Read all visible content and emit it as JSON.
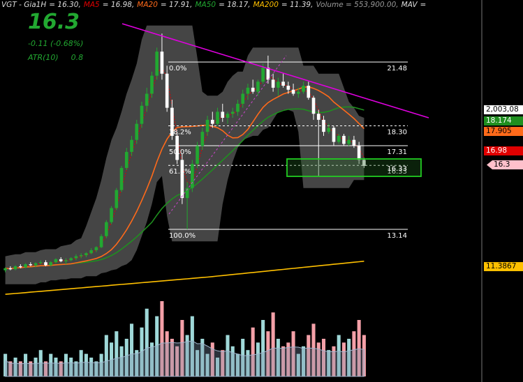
{
  "header": {
    "symbol": "VGT - Gia1H",
    "price_text": "= 16.30,",
    "ma5_label": "MA5",
    "ma5_text": "= 16.98,",
    "ma20_label": "MA20",
    "ma20_text": "= 17.91,",
    "ma50_label": "MA50",
    "ma50_text": "= 18.17,",
    "ma200_label": "MA200",
    "ma200_text": "= 11.39,",
    "volume_text": "Volume = 553,900.00,",
    "mav_label": "MAV",
    "mav_text": "="
  },
  "quote": {
    "price": "16.3",
    "change": "-0.11  (-0.68%)",
    "atr_label": "ATR(10)",
    "atr_value": "0.8"
  },
  "axis_tags": [
    {
      "text": "2,003,08",
      "bg": "#ffffff",
      "fg": "#000000"
    },
    {
      "text": "18.174",
      "bg": "#1f8f1f",
      "fg": "#ffffff"
    },
    {
      "text": "17.905",
      "bg": "#ff6a1a",
      "fg": "#000000"
    },
    {
      "text": "16.98",
      "bg": "#e00000",
      "fg": "#ffffff"
    },
    {
      "text": "16.3",
      "bg": "#ffc0cb",
      "fg": "#000000"
    },
    {
      "text": "11.3867",
      "bg": "#ffc000",
      "fg": "#000000"
    }
  ],
  "colors": {
    "up": "#22a831",
    "down": "#ffffff",
    "ma5": "#e00000",
    "ma20": "#ff6a1a",
    "ma50": "#1f8f1f",
    "ma200": "#ffc000",
    "trendline": "#e000e0",
    "box": "#22cc22",
    "vol_up": "#9fd8d8",
    "vol_down": "#f4a0a8"
  },
  "chart_data": {
    "type": "candlestick",
    "title": "VGT - Gia1H",
    "ylim": [
      9.5,
      24.0
    ],
    "grid": false,
    "fibonacci": [
      {
        "label": "0.0%",
        "value": 21.48
      },
      {
        "label": "38.2%",
        "value": 18.3
      },
      {
        "label": "50.0%",
        "value": 17.31
      },
      {
        "label": "61.8%",
        "value": 16.33
      },
      {
        "label": "100.0%",
        "value": 13.14
      }
    ],
    "candles": [
      [
        11.1,
        11.25,
        11.0,
        11.2
      ],
      [
        11.2,
        11.3,
        11.1,
        11.15
      ],
      [
        11.15,
        11.35,
        11.1,
        11.3
      ],
      [
        11.3,
        11.4,
        11.2,
        11.25
      ],
      [
        11.25,
        11.45,
        11.2,
        11.4
      ],
      [
        11.4,
        11.5,
        11.3,
        11.35
      ],
      [
        11.35,
        11.5,
        11.25,
        11.45
      ],
      [
        11.45,
        11.6,
        11.4,
        11.5
      ],
      [
        11.5,
        11.6,
        11.3,
        11.35
      ],
      [
        11.35,
        11.55,
        11.3,
        11.5
      ],
      [
        11.5,
        11.7,
        11.45,
        11.65
      ],
      [
        11.65,
        11.75,
        11.5,
        11.55
      ],
      [
        11.55,
        11.7,
        11.4,
        11.6
      ],
      [
        11.6,
        11.75,
        11.55,
        11.7
      ],
      [
        11.7,
        11.9,
        11.6,
        11.8
      ],
      [
        11.8,
        11.95,
        11.7,
        11.85
      ],
      [
        11.85,
        12.0,
        11.75,
        11.95
      ],
      [
        11.95,
        12.2,
        11.9,
        12.1
      ],
      [
        12.1,
        12.3,
        12.0,
        12.25
      ],
      [
        12.25,
        12.9,
        12.2,
        12.8
      ],
      [
        12.8,
        13.6,
        12.7,
        13.5
      ],
      [
        13.5,
        14.3,
        13.4,
        14.2
      ],
      [
        14.2,
        15.2,
        14.1,
        15.1
      ],
      [
        15.1,
        16.3,
        15.0,
        16.2
      ],
      [
        16.2,
        17.2,
        16.1,
        17.0
      ],
      [
        17.0,
        17.8,
        16.8,
        17.6
      ],
      [
        17.6,
        18.6,
        17.4,
        18.4
      ],
      [
        18.4,
        19.5,
        18.2,
        19.3
      ],
      [
        19.3,
        20.2,
        19.0,
        19.9
      ],
      [
        19.9,
        21.0,
        19.7,
        20.8
      ],
      [
        20.8,
        22.2,
        20.6,
        22.0
      ],
      [
        22.0,
        22.9,
        20.6,
        20.9
      ],
      [
        20.9,
        21.3,
        19.0,
        19.2
      ],
      [
        19.2,
        19.6,
        17.6,
        17.8
      ],
      [
        17.8,
        18.0,
        16.4,
        16.6
      ],
      [
        16.6,
        16.9,
        14.4,
        14.7
      ],
      [
        14.7,
        15.5,
        13.14,
        15.2
      ],
      [
        15.2,
        16.6,
        15.0,
        16.4
      ],
      [
        16.4,
        17.5,
        16.2,
        17.3
      ],
      [
        17.3,
        18.2,
        17.1,
        18.0
      ],
      [
        18.0,
        18.8,
        17.8,
        18.6
      ],
      [
        18.6,
        19.0,
        18.2,
        18.4
      ],
      [
        18.4,
        19.2,
        18.3,
        19.0
      ],
      [
        19.0,
        19.4,
        18.5,
        18.7
      ],
      [
        18.7,
        19.0,
        18.4,
        18.9
      ],
      [
        18.9,
        19.2,
        18.7,
        19.0
      ],
      [
        19.0,
        19.6,
        18.8,
        19.4
      ],
      [
        19.4,
        20.1,
        19.2,
        19.9
      ],
      [
        19.9,
        20.4,
        19.6,
        20.2
      ],
      [
        20.2,
        20.6,
        19.9,
        20.0
      ],
      [
        20.0,
        20.6,
        19.8,
        20.5
      ],
      [
        20.5,
        21.4,
        20.4,
        21.2
      ],
      [
        21.2,
        21.8,
        20.4,
        20.6
      ],
      [
        20.6,
        20.9,
        20.0,
        20.2
      ],
      [
        20.2,
        20.7,
        19.8,
        20.5
      ],
      [
        20.5,
        20.9,
        20.2,
        20.3
      ],
      [
        20.3,
        20.5,
        19.9,
        20.1
      ],
      [
        20.1,
        20.4,
        19.8,
        19.9
      ],
      [
        19.9,
        20.2,
        19.7,
        20.0
      ],
      [
        20.0,
        20.5,
        19.9,
        20.3
      ],
      [
        20.3,
        20.5,
        19.6,
        19.7
      ],
      [
        19.7,
        19.8,
        18.6,
        18.9
      ],
      [
        18.9,
        19.1,
        15.8,
        18.6
      ],
      [
        18.6,
        18.8,
        17.8,
        18.0
      ],
      [
        18.0,
        18.4,
        17.9,
        18.2
      ],
      [
        18.2,
        18.3,
        17.3,
        17.5
      ],
      [
        17.5,
        17.9,
        17.4,
        17.8
      ],
      [
        17.8,
        17.9,
        17.3,
        17.4
      ],
      [
        17.4,
        17.8,
        17.3,
        17.6
      ],
      [
        17.6,
        17.8,
        17.2,
        17.3
      ],
      [
        17.3,
        17.5,
        16.4,
        16.6
      ],
      [
        16.6,
        16.7,
        16.2,
        16.3
      ]
    ],
    "volume": [
      0.3,
      0.2,
      0.25,
      0.2,
      0.3,
      0.2,
      0.25,
      0.35,
      0.2,
      0.3,
      0.25,
      0.2,
      0.3,
      0.25,
      0.2,
      0.35,
      0.3,
      0.25,
      0.2,
      0.3,
      0.55,
      0.45,
      0.6,
      0.4,
      0.5,
      0.7,
      0.35,
      0.65,
      0.9,
      0.45,
      0.8,
      1.0,
      0.6,
      0.5,
      0.4,
      0.75,
      0.55,
      0.8,
      0.35,
      0.5,
      0.3,
      0.45,
      0.25,
      0.35,
      0.55,
      0.4,
      0.3,
      0.5,
      0.35,
      0.65,
      0.45,
      0.75,
      0.6,
      0.85,
      0.5,
      0.4,
      0.45,
      0.6,
      0.3,
      0.4,
      0.55,
      0.7,
      0.45,
      0.5,
      0.35,
      0.4,
      0.55,
      0.45,
      0.5,
      0.6,
      0.75,
      0.55
    ]
  }
}
